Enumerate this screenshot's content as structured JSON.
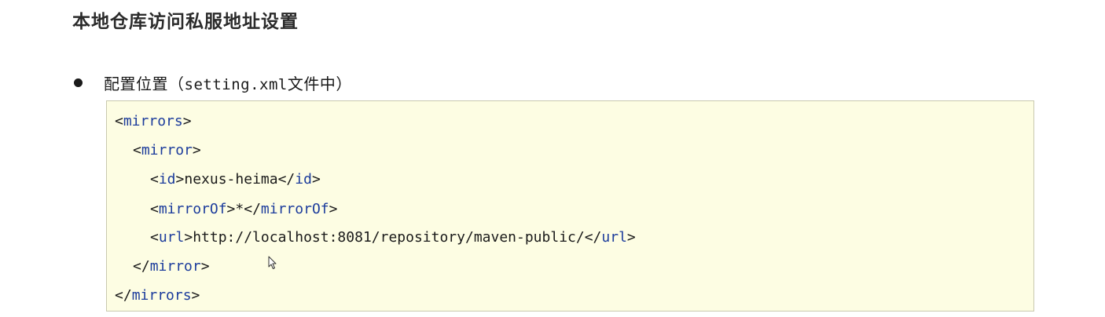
{
  "heading": "本地仓库访问私服地址设置",
  "bullet": {
    "prefix": "配置位置（",
    "file": "setting.xml",
    "suffix": "文件中）"
  },
  "colors": {
    "tag": "#1c3c9c",
    "code_background": "#fdfde3",
    "code_border": "#c9c9b0"
  },
  "code": {
    "mirrors_tag": "mirrors",
    "mirror_tag": "mirror",
    "id_tag": "id",
    "id_value": "nexus-heima",
    "mirrorOf_tag": "mirrorOf",
    "mirrorOf_value": "*",
    "url_tag": "url",
    "url_value": "http://localhost:8081/repository/maven-public/"
  },
  "cursor_icon": "mouse-pointer-icon"
}
